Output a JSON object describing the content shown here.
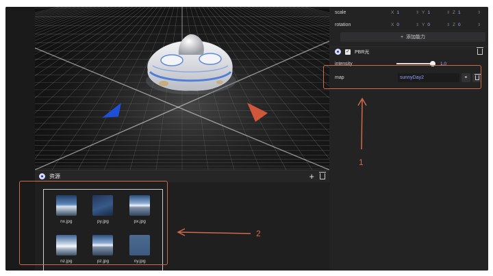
{
  "properties": {
    "scale": {
      "label": "scale",
      "x": "1",
      "y": "1",
      "z": "1"
    },
    "rotation": {
      "label": "rotation",
      "x": "0",
      "y": "0",
      "z": "0"
    },
    "axis_labels": {
      "x": "X",
      "y": "Y",
      "z": "Z"
    },
    "add_button": {
      "icon": "+",
      "label": "添加能力"
    }
  },
  "pbr": {
    "title": "PBR光",
    "checked": "✓",
    "intensity": {
      "label": "intensity",
      "value": "1.0",
      "fraction": 0.95
    },
    "map": {
      "label": "map",
      "value": "sunnyDay2",
      "link_icon": "link-icon",
      "delete_icon": "trash-icon"
    }
  },
  "assets": {
    "title": "资源",
    "add_icon": "+",
    "files": [
      {
        "name": "nx.jpg",
        "style": "sky"
      },
      {
        "name": "py.jpg",
        "style": "dark"
      },
      {
        "name": "px.jpg",
        "style": "horizon"
      },
      {
        "name": "nz.jpg",
        "style": "cloud"
      },
      {
        "name": "pz.jpg",
        "style": "horizon"
      },
      {
        "name": "ny.jpg",
        "style": "blank"
      }
    ]
  },
  "annotations": {
    "one": "1",
    "two": "2",
    "color": "#d26a4a"
  },
  "colors": {
    "accent_value": "#8fa1ff",
    "panel_bg": "#232324",
    "axis_blue": "#1e4fd8",
    "axis_red": "#d0563c"
  }
}
